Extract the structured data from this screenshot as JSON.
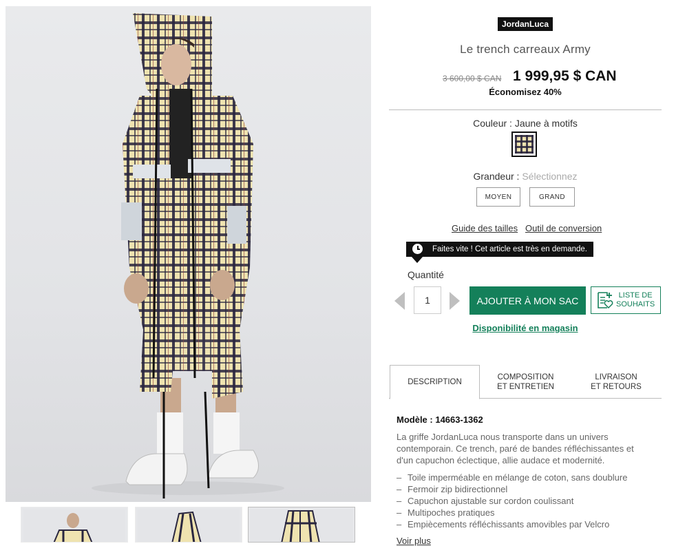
{
  "product": {
    "brand": "JordanLuca",
    "title": "Le trench carreaux Army",
    "old_price": "3 600,00 $ CAN",
    "price": "1 999,95 $ CAN",
    "savings": "Économisez 40%"
  },
  "color": {
    "label": "Couleur : Jaune à motifs",
    "swatch_colors": [
      "#efe3b0",
      "#2a2740"
    ]
  },
  "size": {
    "label": "Grandeur : ",
    "placeholder": "Sélectionnez",
    "options": [
      "MOYEN",
      "GRAND"
    ]
  },
  "links": {
    "size_guide": "Guide des tailles",
    "conversion_tool": "Outil de conversion"
  },
  "alert": {
    "icon": "clock-icon",
    "message": "Faites vite ! Cet article est très en demande."
  },
  "quantity": {
    "label": "Quantité",
    "value": "1"
  },
  "actions": {
    "add_to_bag": "AJOUTER À MON SAC",
    "wishlist_line1": "LISTE DE",
    "wishlist_line2": "SOUHAITS",
    "store_availability": "Disponibilité en magasin"
  },
  "tabs": [
    {
      "line1": "DESCRIPTION",
      "line2": ""
    },
    {
      "line1": "COMPOSITION",
      "line2": "ET ENTRETIEN"
    },
    {
      "line1": "LIVRAISON",
      "line2": "ET RETOURS"
    }
  ],
  "details": {
    "model": "Modèle : 14663-1362",
    "description": "La griffe JordanLuca nous transporte dans un univers contemporain. Ce trench, paré de bandes réfléchissantes et d'un capuchon éclectique, allie audace et modernité.",
    "features": [
      "Toile imperméable en mélange de coton, sans doublure",
      "Fermoir zip bidirectionnel",
      "Capuchon ajustable sur cordon coulissant",
      "Multipoches pratiques",
      "Empiècements réfléchissants amovibles par Velcro"
    ],
    "see_more": "Voir plus"
  },
  "colors": {
    "accent_green": "#14805a",
    "brand_badge": "#111111",
    "plaid_base": "#efe3b0",
    "plaid_line": "#2a2740"
  }
}
